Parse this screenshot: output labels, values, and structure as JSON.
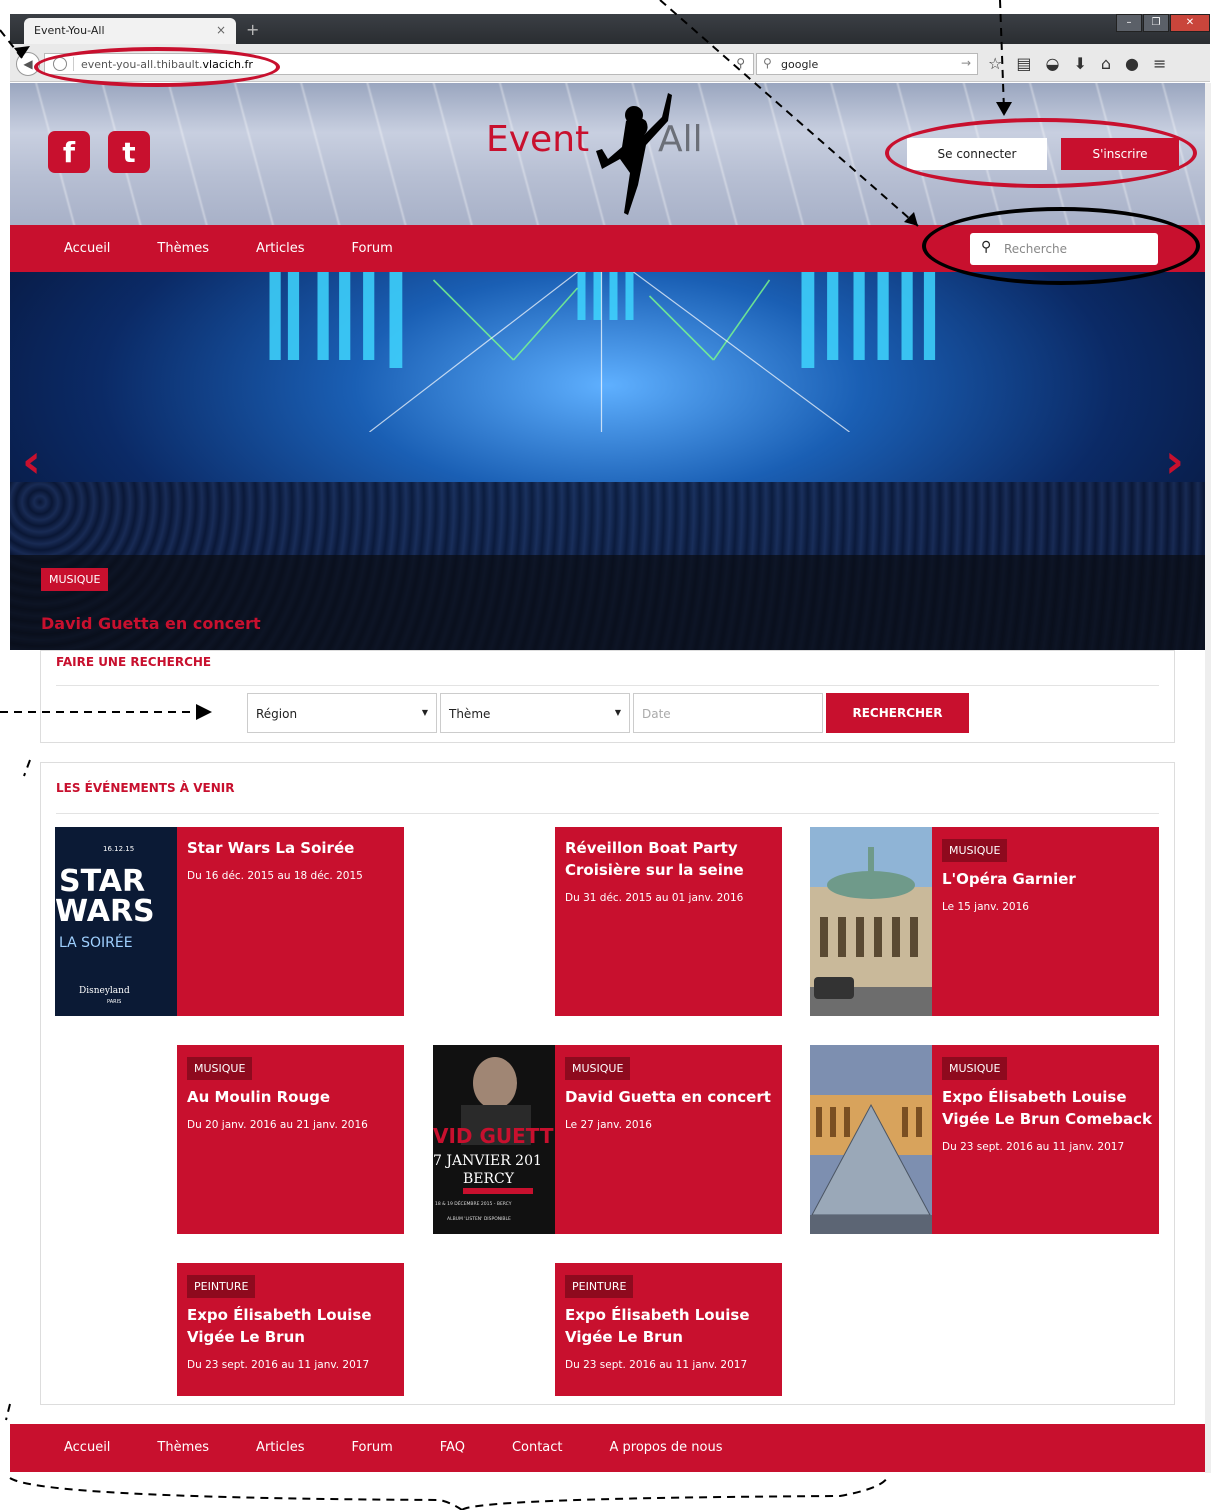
{
  "browser": {
    "tab_title": "Event-You-All",
    "tab_close": "×",
    "new_tab": "+",
    "url_prefix": "event-you-all.thibault.",
    "url_domain": "vlacich.fr",
    "search_value": "google",
    "window_controls": [
      "minimize-icon",
      "restore-icon",
      "close-icon"
    ],
    "toolbar_icons": [
      "star-icon",
      "reading-list-icon",
      "pocket-icon",
      "download-icon",
      "home-icon",
      "chat-icon",
      "menu-icon"
    ]
  },
  "header": {
    "logo_left": "Event",
    "logo_right": "All",
    "social": [
      "facebook-icon",
      "twitter-icon"
    ],
    "login_label": "Se connecter",
    "signup_label": "S'inscrire"
  },
  "nav": {
    "items": [
      "Accueil",
      "Thèmes",
      "Articles",
      "Forum"
    ],
    "search_placeholder": "Recherche"
  },
  "hero": {
    "badge": "MUSIQUE",
    "title": "David Guetta en concert"
  },
  "search_panel": {
    "title": "FAIRE UNE RECHERCHE",
    "region": "Région",
    "theme": "Thème",
    "date_placeholder": "Date",
    "button": "RECHERCHER"
  },
  "events": {
    "title": "LES ÉVÉNEMENTS À VENIR",
    "items": [
      {
        "title": "Star Wars La Soirée",
        "dates": "Du 16 déc. 2015 au 18 déc. 2015",
        "badge": "",
        "thumb_text": [
          "16.12.15",
          "STAR",
          "WARS",
          "LA SOIRÉE",
          "Disneyland",
          "PARIS"
        ]
      },
      {
        "title": "Réveillon Boat Party Croisière sur la seine",
        "dates": "Du 31 déc. 2015 au 01 janv. 2016",
        "badge": ""
      },
      {
        "title": "L'Opéra Garnier",
        "dates": "Le 15 janv. 2016",
        "badge": "MUSIQUE"
      },
      {
        "title": "Au Moulin Rouge",
        "dates": "Du 20 janv. 2016 au 21 janv. 2016",
        "badge": "MUSIQUE"
      },
      {
        "title": "David Guetta en concert",
        "dates": "Le 27 janv. 2016",
        "badge": "MUSIQUE",
        "thumb_text": [
          "VID GUETT",
          "7 JANVIER 201",
          "BERCY",
          "18 & 19 DÉCEMBRE 2015 - BERCY",
          "ALBUM 'LISTEN' DISPONIBLE"
        ]
      },
      {
        "title": "Expo Élisabeth Louise Vigée Le Brun Comeback",
        "dates": "Du 23 sept. 2016 au 11 janv. 2017",
        "badge": "MUSIQUE"
      },
      {
        "title": "Expo Élisabeth Louise Vigée Le Brun",
        "dates": "Du 23 sept. 2016 au 11 janv. 2017",
        "badge": "PEINTURE"
      },
      {
        "title": "Expo Élisabeth Louise Vigée Le Brun",
        "dates": "Du 23 sept. 2016 au 11 janv. 2017",
        "badge": "PEINTURE"
      }
    ]
  },
  "footer": {
    "items": [
      "Accueil",
      "Thèmes",
      "Articles",
      "Forum",
      "FAQ",
      "Contact",
      "A propos de nous"
    ]
  },
  "colors": {
    "brand": "#c8102e",
    "badge_dark": "#8e0a1e",
    "annotation_red": "#c8102e",
    "annotation_black": "#000000"
  }
}
